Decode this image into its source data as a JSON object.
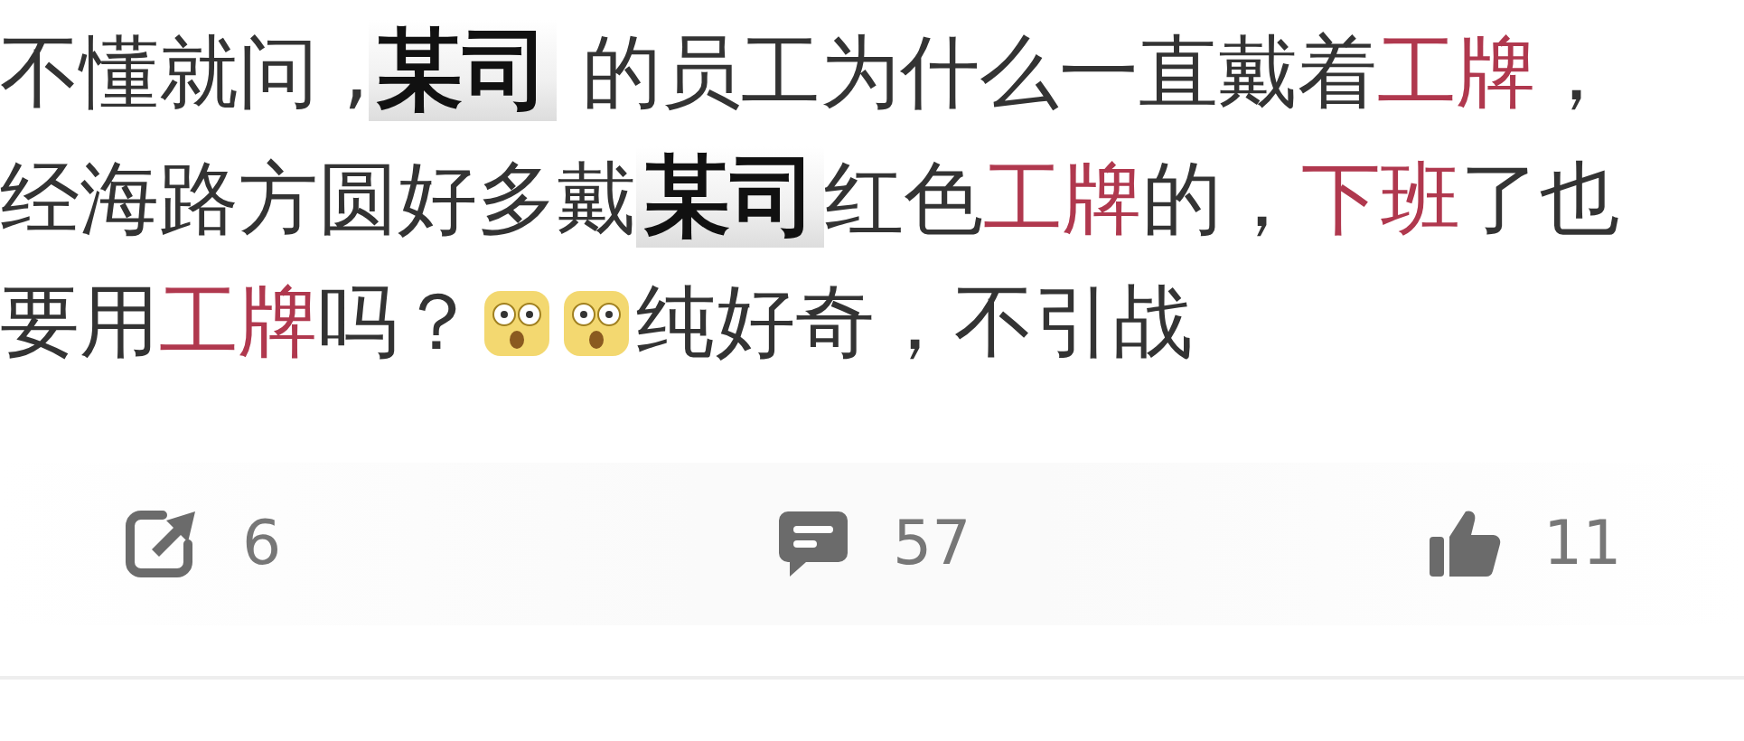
{
  "post": {
    "lines": [
      [
        {
          "kind": "text",
          "text": "不懂就问 ,"
        },
        {
          "kind": "mask",
          "text": "某司"
        },
        {
          "kind": "text",
          "text": " 的员工为什么一直戴着"
        },
        {
          "kind": "keyword",
          "text": "工牌"
        },
        {
          "kind": "text",
          "text": "，"
        }
      ],
      [
        {
          "kind": "text",
          "text": "经海路方圆好多戴"
        },
        {
          "kind": "mask",
          "text": "某司"
        },
        {
          "kind": "text",
          "text": "红色"
        },
        {
          "kind": "keyword",
          "text": "工牌"
        },
        {
          "kind": "text",
          "text": "的，"
        },
        {
          "kind": "keyword",
          "text": "下班"
        },
        {
          "kind": "text",
          "text": "了也"
        }
      ],
      [
        {
          "kind": "text",
          "text": "要用"
        },
        {
          "kind": "keyword",
          "text": "工牌"
        },
        {
          "kind": "text",
          "text": "吗？"
        },
        {
          "kind": "emoji"
        },
        {
          "kind": "emoji"
        },
        {
          "kind": "text",
          "text": "纯好奇，不引战"
        }
      ]
    ]
  },
  "actions": [
    {
      "kind": "share",
      "count": "6"
    },
    {
      "kind": "comment",
      "count": "57"
    },
    {
      "kind": "like",
      "count": "11"
    }
  ]
}
